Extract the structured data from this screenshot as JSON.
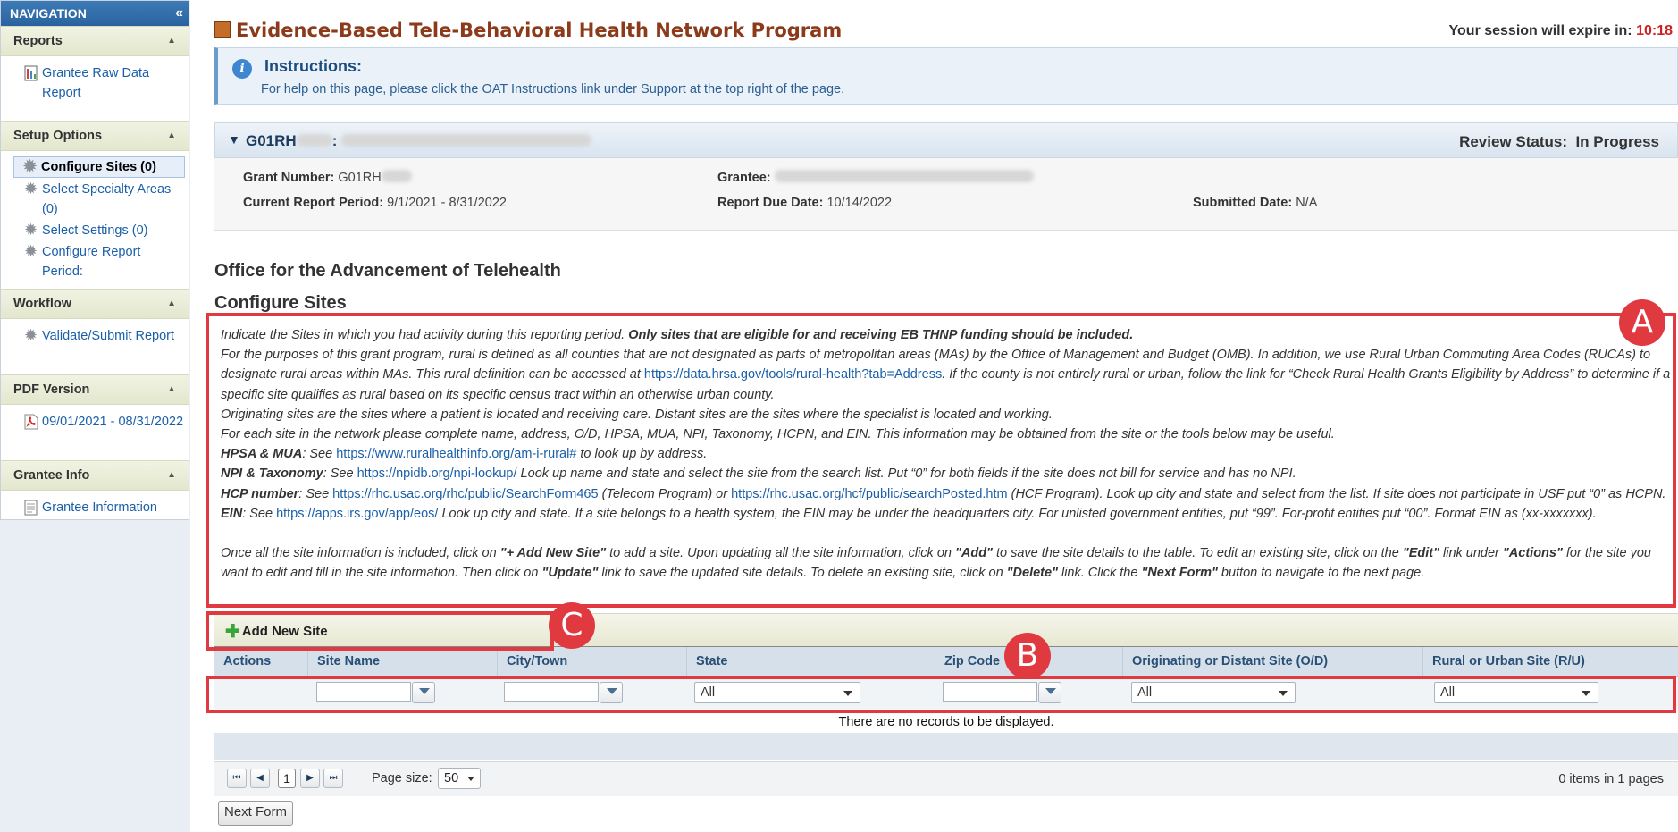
{
  "nav": {
    "title": "NAVIGATION",
    "collapse_icon": "«",
    "sections": [
      {
        "label": "Reports",
        "items": [
          {
            "label": "Grantee Raw Data Report",
            "icon": "report-icon"
          }
        ]
      },
      {
        "label": "Setup Options",
        "items": [
          {
            "label": "Configure Sites (0)",
            "icon": "gear-icon",
            "active": true
          },
          {
            "label": "Select Specialty Areas (0)",
            "icon": "gear-icon"
          },
          {
            "label": "Select Settings (0)",
            "icon": "gear-icon"
          },
          {
            "label": "Configure Report Period:",
            "icon": "gear-icon"
          }
        ]
      },
      {
        "label": "Workflow",
        "items": [
          {
            "label": "Validate/Submit Report",
            "icon": "gear-icon"
          }
        ]
      },
      {
        "label": "PDF Version",
        "items": [
          {
            "label": "09/01/2021 - 08/31/2022",
            "icon": "pdf-icon"
          }
        ]
      },
      {
        "label": "Grantee Info",
        "items": [
          {
            "label": "Grantee Information",
            "icon": "document-icon"
          }
        ]
      }
    ]
  },
  "header": {
    "title": "Evidence-Based Tele-Behavioral Health Network Program",
    "session_label": "Your session will expire in:",
    "session_timer": "10:18"
  },
  "instructions": {
    "title": "Instructions:",
    "text": "For help on this page, please click the OAT Instructions link under Support at the top right of the page."
  },
  "grant": {
    "id_prefix": "G01RH",
    "review_label": "Review Status:",
    "review_value": "In Progress",
    "grant_number_label": "Grant Number:",
    "grant_number_value": "G01RH",
    "grantee_label": "Grantee:",
    "period_label": "Current Report Period:",
    "period_value": "9/1/2021 - 8/31/2022",
    "due_label": "Report Due Date:",
    "due_value": "10/14/2022",
    "submitted_label": "Submitted Date:",
    "submitted_value": "N/A"
  },
  "section": {
    "org_title": "Office for the Advancement of Telehealth",
    "page_heading": "Configure Sites"
  },
  "desc": {
    "l1a": "Indicate the Sites in which you had activity during this reporting period. ",
    "l1b": "Only sites that are eligible for and receiving EB THNP funding should be included.",
    "l2a": "For the purposes of this grant program, rural is defined as all counties that are not designated as parts of metropolitan areas (MAs) by the Office of Management and Budget (OMB). In addition, we use Rural Urban Commuting Area Codes (RUCAs) to designate rural areas within MAs. This rural definition can be accessed at ",
    "l2link": "https://data.hrsa.gov/tools/rural-health?tab=Address",
    "l2b": ". If the county is not entirely rural or urban, follow the link for “Check Rural Health Grants Eligibility by Address” to determine if a specific site qualifies as rural based on its specific census tract within an otherwise urban county.",
    "l3": "Originating sites are the sites where a patient is located and receiving care. Distant sites are the sites where the specialist is located and working.",
    "l4": "For each site in the network please complete name, address, O/D, HPSA, MUA, NPI, Taxonomy, HCPN, and EIN. This information may be obtained from the site or the tools below may be useful.",
    "hpsa_label": "HPSA & MUA",
    "hpsa_see": ": See ",
    "hpsa_link": "https://www.ruralhealthinfo.org/am-i-rural#",
    "hpsa_rest": " to look up by address.",
    "npi_label": "NPI & Taxonomy",
    "npi_see": ": See ",
    "npi_link": "https://npidb.org/npi-lookup/",
    "npi_rest": " Look up name and state and select the site from the search list. Put “0” for both fields if the site does not bill for service and has no NPI.",
    "hcp_label": "HCP number",
    "hcp_see": ": See ",
    "hcp_link1": "https://rhc.usac.org/rhc/public/SearchForm465",
    "hcp_mid": " (Telecom Program) or ",
    "hcp_link2": "https://rhc.usac.org/hcf/public/searchPosted.htm",
    "hcp_rest": " (HCF Program). Look up city and state and select from the list. If site does not participate in USF put “0” as HCPN.",
    "ein_label": "EIN",
    "ein_see": ": See ",
    "ein_link": "https://apps.irs.gov/app/eos/",
    "ein_rest": " Look up city and state. If a site belongs to a health system, the EIN may be under the headquarters city. For unlisted government entities, put “99”. For-profit entities put “00”. Format EIN as (xx-xxxxxxx).",
    "p6a": "Once all the site information is included, click on ",
    "p6b": "\"+ Add New Site\"",
    "p6c": " to add a site. Upon updating all the site information, click on ",
    "p6d": "\"Add\"",
    "p6e": " to save the site details to the table. To edit an existing site, click on the ",
    "p6f": "\"Edit\"",
    "p6g": " link under ",
    "p6h": "\"Actions\"",
    "p6i": " for the site you want to edit and fill in the site information. Then click on ",
    "p6j": "\"Update\"",
    "p6k": " link to save the updated site details. To delete an existing site, click on ",
    "p6l": "\"Delete\"",
    "p6m": " link. Click the ",
    "p6n": "\"Next Form\"",
    "p6o": " button to navigate to the next page."
  },
  "toolbar": {
    "add_label": "Add New Site"
  },
  "grid": {
    "columns": [
      "Actions",
      "Site Name",
      "City/Town",
      "State",
      "Zip Code",
      "Originating or Distant Site (O/D)",
      "Rural or Urban Site (R/U)"
    ],
    "filter_all": "All",
    "empty_text": "There are no records to be displayed."
  },
  "pager": {
    "first": "⏮",
    "prev": "◀",
    "next": "▶",
    "last": "⏭",
    "current_page": "1",
    "page_size_label": "Page size:",
    "page_size": "50",
    "info": "0 items in 1 pages"
  },
  "next_form_label": "Next Form",
  "annotations": {
    "a": "A",
    "b": "B",
    "c": "C"
  },
  "colors": {
    "annotation": "#e0393f",
    "title": "#8b3a1a",
    "link": "#1a5fa8",
    "timer": "#cc2222"
  }
}
